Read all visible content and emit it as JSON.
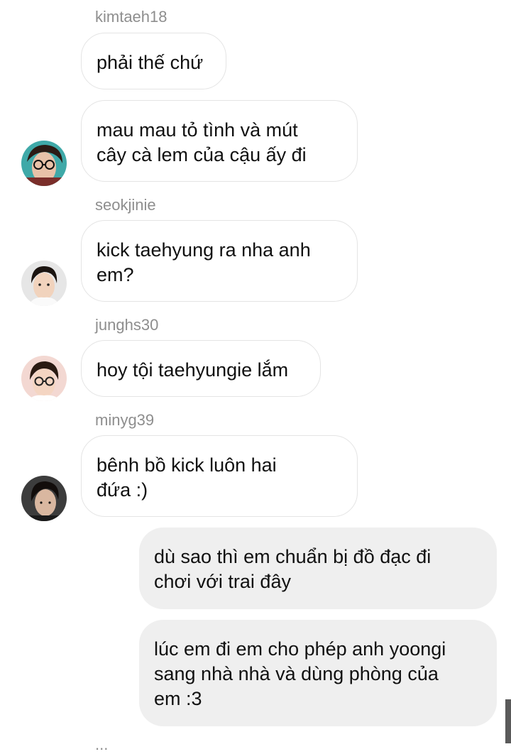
{
  "messages": [
    {
      "username": "kimtaeh18",
      "text": "phải thế chứ"
    },
    {
      "text": "mau mau tỏ tình và mút\ncây cà lem của cậu ấy đi",
      "avatar": "avatar-kimtaeh18"
    },
    {
      "username": "seokjinie",
      "text": "kick taehyung ra nha anh\nem?",
      "avatar": "avatar-seokjinie"
    },
    {
      "username": "junghs30",
      "text": "hoy tội taehyungie lắm",
      "avatar": "avatar-junghs30"
    },
    {
      "username": "minyg39",
      "text": "bênh bồ kick luôn hai\nđứa :)",
      "avatar": "avatar-minyg39"
    },
    {
      "text": "dù sao thì em chuẩn bị đồ đạc đi\nchơi với trai đây"
    },
    {
      "text": "lúc em đi em cho phép anh yoongi\nsang nhà nhà và dùng phòng của\nem :3"
    }
  ],
  "cut_off_username": "..."
}
